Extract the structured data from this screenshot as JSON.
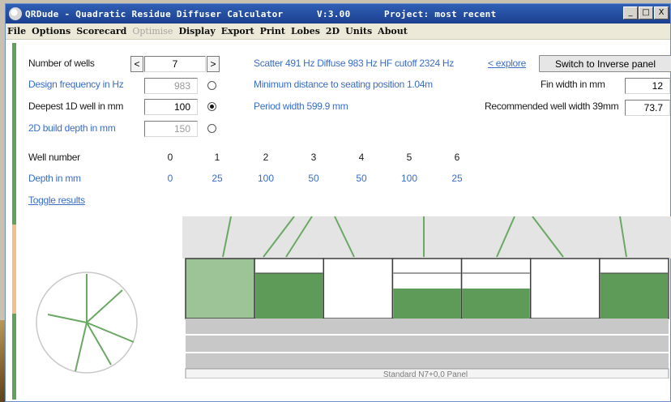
{
  "window": {
    "title": "QRDude - Quadratic Residue Diffuser Calculator      V:3.00      Project: most recent",
    "controls": [
      "_",
      "□",
      "X"
    ]
  },
  "menu": [
    {
      "label": "File",
      "enabled": true
    },
    {
      "label": "Options",
      "enabled": true
    },
    {
      "label": "Scorecard",
      "enabled": true
    },
    {
      "label": "Optimise",
      "enabled": false
    },
    {
      "label": "Display",
      "enabled": true
    },
    {
      "label": "Export",
      "enabled": true
    },
    {
      "label": "Print",
      "enabled": true
    },
    {
      "label": "Lobes",
      "enabled": true
    },
    {
      "label": "2D",
      "enabled": true
    },
    {
      "label": "Units",
      "enabled": true
    },
    {
      "label": "About",
      "enabled": true
    }
  ],
  "params": {
    "wells": {
      "label": "Number of wells",
      "value": "7",
      "dec": "<",
      "inc": ">"
    },
    "design_freq": {
      "label": "Design frequency in Hz",
      "value": "983"
    },
    "deepest": {
      "label": "Deepest 1D well in mm",
      "value": "100"
    },
    "build_depth": {
      "label": "2D build depth in mm",
      "value": "150"
    },
    "selected_radio": "deepest"
  },
  "info": {
    "scatter": "Scatter 491 Hz  Diffuse 983 Hz  HF cutoff 2324 Hz",
    "min_distance": "Minimum distance to seating position  1.04m",
    "period": "Period width  599.9 mm",
    "explore": "< explore",
    "switch_btn": "Switch to Inverse panel",
    "fin_label": "Fin width in mm",
    "fin_value": "12",
    "rec_label": "Recommended well width  39mm",
    "rec_value": "73.7"
  },
  "table": {
    "well_label": "Well number",
    "depth_label": "Depth in mm",
    "wells": [
      "0",
      "1",
      "2",
      "3",
      "4",
      "5",
      "6"
    ],
    "depths": [
      "0",
      "25",
      "100",
      "50",
      "50",
      "100",
      "25"
    ]
  },
  "toggle_results": "Toggle results",
  "diagram": {
    "caption": "Standard N7+0,0 Panel",
    "fill": "#5e9a58",
    "fill_light": "#9dc496",
    "depths_mm": [
      0,
      25,
      100,
      50,
      50,
      100,
      25
    ],
    "max_depth_mm": 100
  },
  "colors": {
    "accent_blue": "#3a6ec7",
    "green": "#5fa35a",
    "orange": "#f2c08c"
  }
}
